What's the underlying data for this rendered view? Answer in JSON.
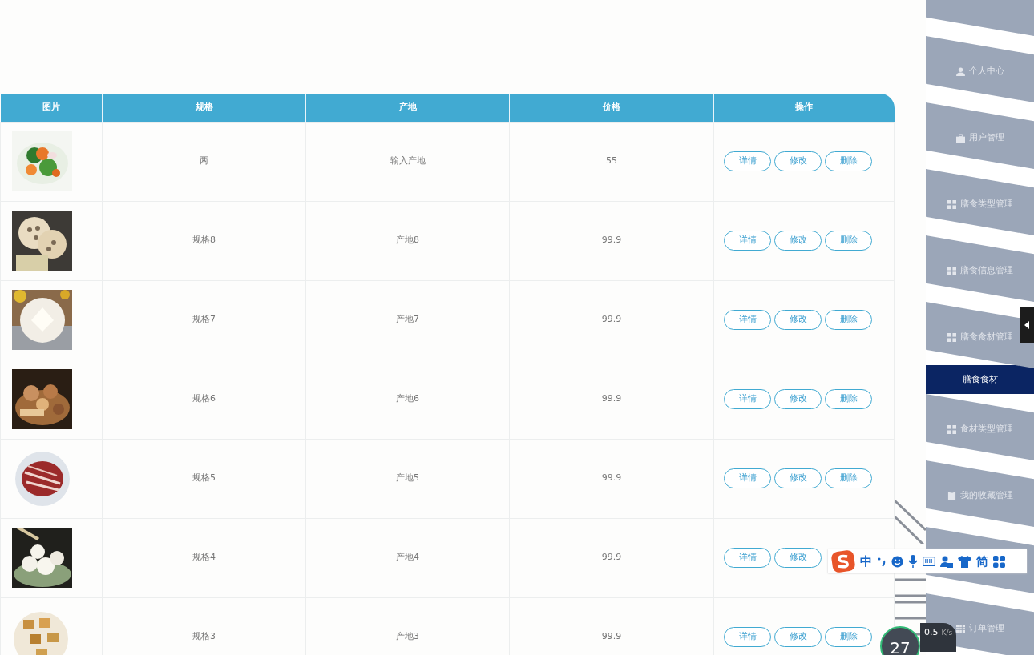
{
  "table": {
    "columns": [
      "图片",
      "规格",
      "产地",
      "价格",
      "操作"
    ],
    "rows": [
      {
        "spec": "两",
        "origin": "输入产地",
        "price": "55",
        "actions": [
          "详情",
          "修改",
          "删除"
        ]
      },
      {
        "spec": "规格8",
        "origin": "产地8",
        "price": "99.9",
        "actions": [
          "详情",
          "修改",
          "删除"
        ]
      },
      {
        "spec": "规格7",
        "origin": "产地7",
        "price": "99.9",
        "actions": [
          "详情",
          "修改",
          "删除"
        ]
      },
      {
        "spec": "规格6",
        "origin": "产地6",
        "price": "99.9",
        "actions": [
          "详情",
          "修改",
          "删除"
        ]
      },
      {
        "spec": "规格5",
        "origin": "产地5",
        "price": "99.9",
        "actions": [
          "详情",
          "修改",
          "删除"
        ]
      },
      {
        "spec": "规格4",
        "origin": "产地4",
        "price": "99.9",
        "actions": [
          "详情",
          "修改"
        ]
      },
      {
        "spec": "规格3",
        "origin": "产地3",
        "price": "99.9",
        "actions": [
          "详情",
          "修改",
          "删除"
        ]
      }
    ]
  },
  "sidebar": {
    "items": [
      {
        "label": "个人中心",
        "kind": "user",
        "selected": false
      },
      {
        "label": "用户管理",
        "kind": "briefcase",
        "selected": false
      },
      {
        "label": "膳食类型管理",
        "kind": "grid",
        "selected": false
      },
      {
        "label": "膳食信息管理",
        "kind": "grid",
        "selected": false
      },
      {
        "label": "膳食食材管理",
        "kind": "grid",
        "selected": false
      },
      {
        "label": "膳食食材",
        "kind": "plain",
        "selected": true
      },
      {
        "label": "食材类型管理",
        "kind": "grid",
        "selected": false
      },
      {
        "label": "我的收藏管理",
        "kind": "clipboard",
        "selected": false
      },
      {
        "kind": "blank",
        "selected": false
      },
      {
        "label": "订单管理",
        "kind": "table",
        "selected": false
      }
    ]
  },
  "ime_toolbar": {
    "mode": "中",
    "script": "简"
  },
  "net_monitor": {
    "percent": "27",
    "speed": "0.5",
    "unit": "K/s"
  }
}
